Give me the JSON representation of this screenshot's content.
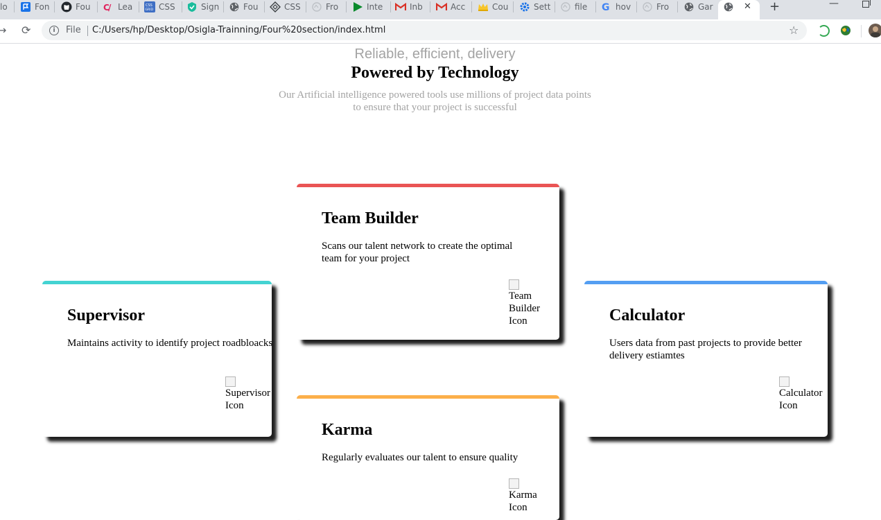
{
  "browser": {
    "tabs": [
      {
        "label": "lo",
        "icon": "blank-icon"
      },
      {
        "label": "Fon",
        "icon": "flag-icon"
      },
      {
        "label": "Fou",
        "icon": "github-icon"
      },
      {
        "label": "Lea",
        "icon": "codeacademy-icon"
      },
      {
        "label": "CSS",
        "icon": "css-grid-icon"
      },
      {
        "label": "Sign",
        "icon": "shield-icon"
      },
      {
        "label": "Fou",
        "icon": "globe-icon"
      },
      {
        "label": "CSS",
        "icon": "diamond-icon"
      },
      {
        "label": "Fro",
        "icon": "blank-icon"
      },
      {
        "label": "Inte",
        "icon": "play-icon"
      },
      {
        "label": "Inb",
        "icon": "gmail-icon"
      },
      {
        "label": "Acc",
        "icon": "gmail-icon"
      },
      {
        "label": "Cou",
        "icon": "crown-icon"
      },
      {
        "label": "Sett",
        "icon": "gear-icon"
      },
      {
        "label": "file",
        "icon": "blank-icon"
      },
      {
        "label": "hov",
        "icon": "google-icon"
      },
      {
        "label": "Fro",
        "icon": "blank-icon"
      },
      {
        "label": "Gar",
        "icon": "globe-icon"
      }
    ],
    "active_tab_icon": "globe-icon",
    "close_glyph": "✕",
    "new_tab_glyph": "+",
    "omnibox": {
      "scheme_label": "File",
      "url": "C:/Users/hp/Desktop/Osigla-Trainning/Four%20section/index.html"
    }
  },
  "page": {
    "subtitle": "Reliable, efficient, delivery",
    "title": "Powered by Technology",
    "description": "Our Artificial intelligence powered tools use millions of project data points to ensure that your project is successful",
    "cards": {
      "supervisor": {
        "title": "Supervisor",
        "text": "Maintains activity to identify project roadbloacks",
        "icon_alt": "Supervisor Icon",
        "accent": "#44d3d2"
      },
      "team_builder": {
        "title": "Team Builder",
        "text": "Scans our talent network to create the optimal team for your project",
        "icon_alt": "Team Builder Icon",
        "accent": "#ea5454"
      },
      "karma": {
        "title": "Karma",
        "text": "Regularly evaluates our talent to ensure quality",
        "icon_alt": "Karma Icon",
        "accent": "#fcaf4a"
      },
      "calculator": {
        "title": "Calculator",
        "text": "Users data from past projects to provide better delivery estiamtes",
        "icon_alt": "Calculator Icon",
        "accent": "#549ef2"
      }
    }
  }
}
